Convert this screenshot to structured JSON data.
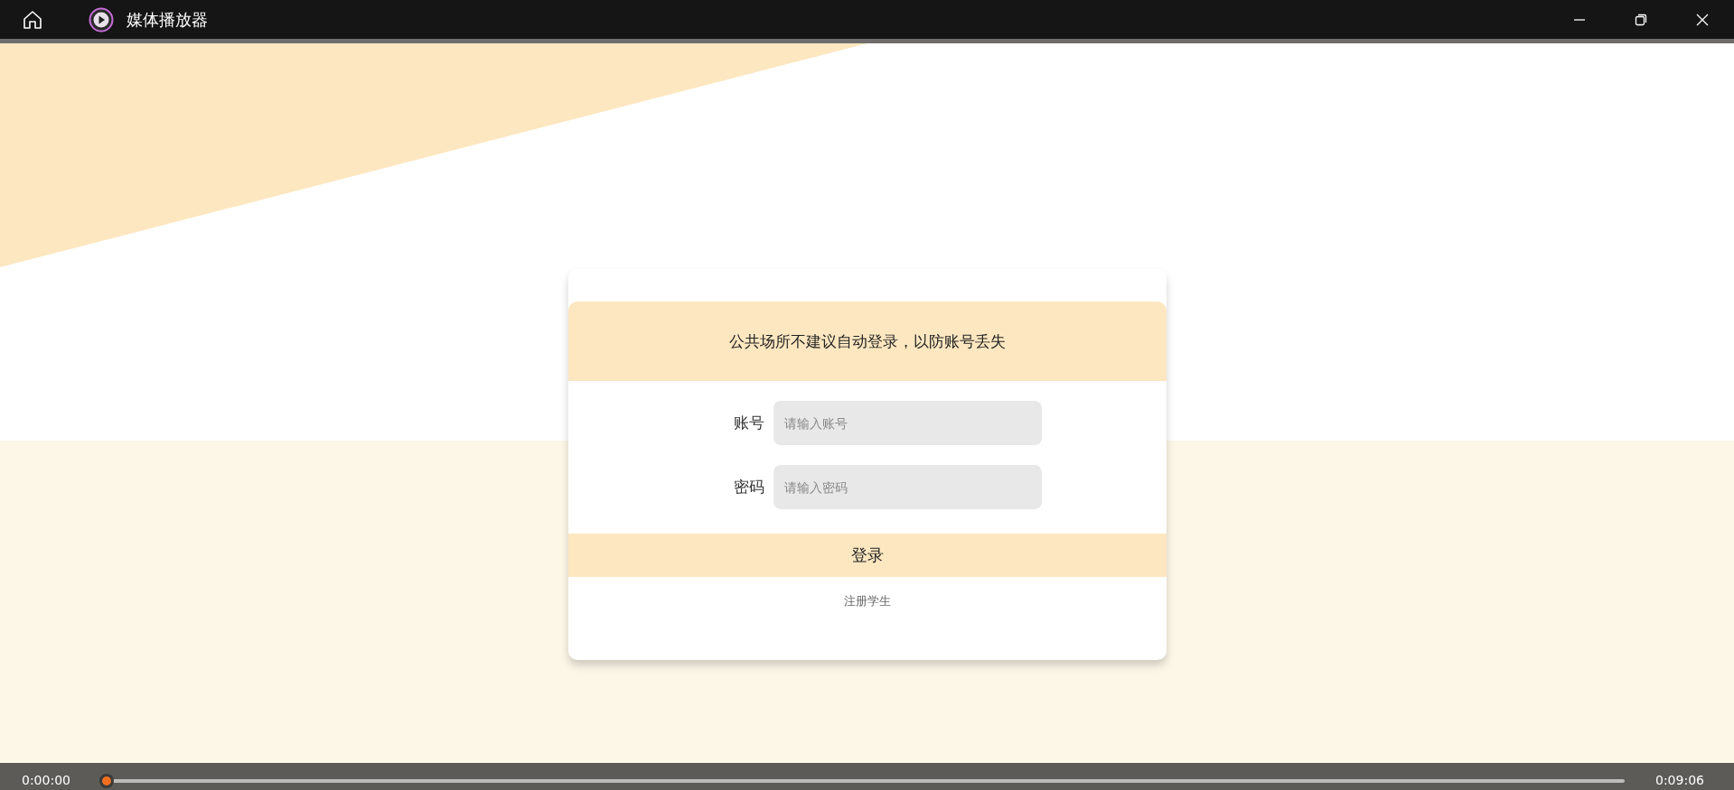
{
  "window": {
    "title": "媒体播放器"
  },
  "login_card": {
    "notice": "公共场所不建议自动登录，以防账号丢失",
    "fields": [
      {
        "label": "账号",
        "placeholder": "请输入账号"
      },
      {
        "label": "密码",
        "placeholder": "请输入密码"
      }
    ],
    "login_button": "登录",
    "register_link": "注册学生"
  },
  "player_bar": {
    "elapsed": "0:00:00",
    "total": "0:09:06",
    "seek": {
      "level": 0
    }
  }
}
